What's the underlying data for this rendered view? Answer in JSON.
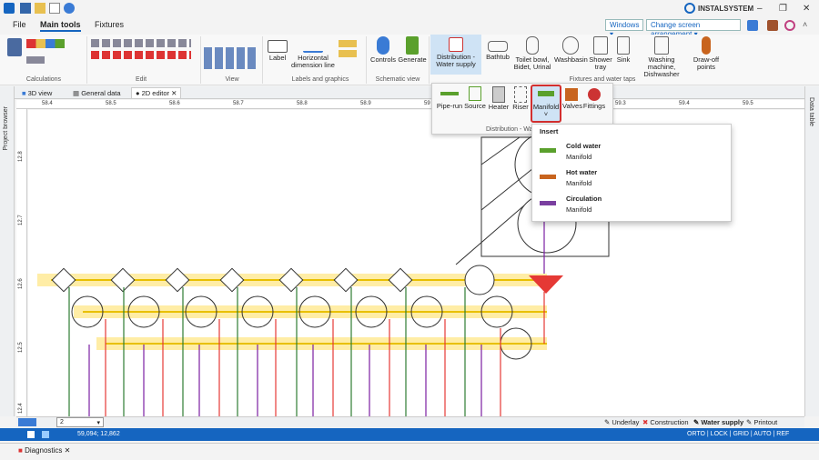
{
  "app": {
    "brand": "INSTALSYSTEM"
  },
  "menu": {
    "file": "File",
    "main_tools": "Main tools",
    "fixtures": "Fixtures"
  },
  "top_right": {
    "windows": "Windows",
    "screen_arrangement": "Change screen arrangement"
  },
  "ribbon": {
    "groups": {
      "calculations": "Calculations",
      "edit": "Edit",
      "view": "View",
      "labels_graphics": "Labels and graphics",
      "schematic_view": "Schematic view",
      "fixtures_taps": "Fixtures and water taps"
    },
    "label": "Label",
    "horizontal_dim": "Horizontal dimension line",
    "controls": "Controls",
    "generate": "Generate",
    "distribution": "Distribution - Water supply",
    "bathtub": "Bathtub",
    "toilet": "Toilet bowl, Bidet, Urinal",
    "washbasin": "Washbasin",
    "shower": "Shower tray",
    "sink": "Sink",
    "washing": "Washing machine, Dishwasher",
    "drawoff": "Draw-off points"
  },
  "tabs": {
    "view3d": "3D view",
    "general": "General data",
    "editor2d": "● 2D editor"
  },
  "side": {
    "left": "Project browser",
    "right": "Data table"
  },
  "ruler": {
    "top": [
      "58.4",
      "58.5",
      "58.6",
      "58.7",
      "58.8",
      "58.9",
      "59",
      "59.3",
      "59.4",
      "59.5"
    ],
    "left": [
      "12.8",
      "12.7",
      "12.6",
      "12.5",
      "12.4"
    ]
  },
  "subpanel": {
    "pipe_run": "Pipe-run",
    "source": "Source",
    "heater": "Heater",
    "riser": "Riser",
    "manifold": "Manifold",
    "valves": "Valves",
    "fittings": "Fittings",
    "caption": "Distribution - Wa"
  },
  "dropdown": {
    "header": "Insert",
    "items": [
      {
        "title": "Cold water",
        "sub": "Manifold",
        "color": "#5aa02c"
      },
      {
        "title": "Hot water",
        "sub": "Manifold",
        "color": "#c8641e"
      },
      {
        "title": "Circulation",
        "sub": "Manifold",
        "color": "#7a3fa0"
      }
    ]
  },
  "bottom": {
    "floor": "2",
    "layers": [
      "Underlay",
      "Construction",
      "Water supply",
      "Printout"
    ],
    "coords": "59,094; 12,862",
    "status_right": "ORTO | LOCK | GRID | AUTO | REF"
  },
  "diagnostics": "Diagnostics"
}
